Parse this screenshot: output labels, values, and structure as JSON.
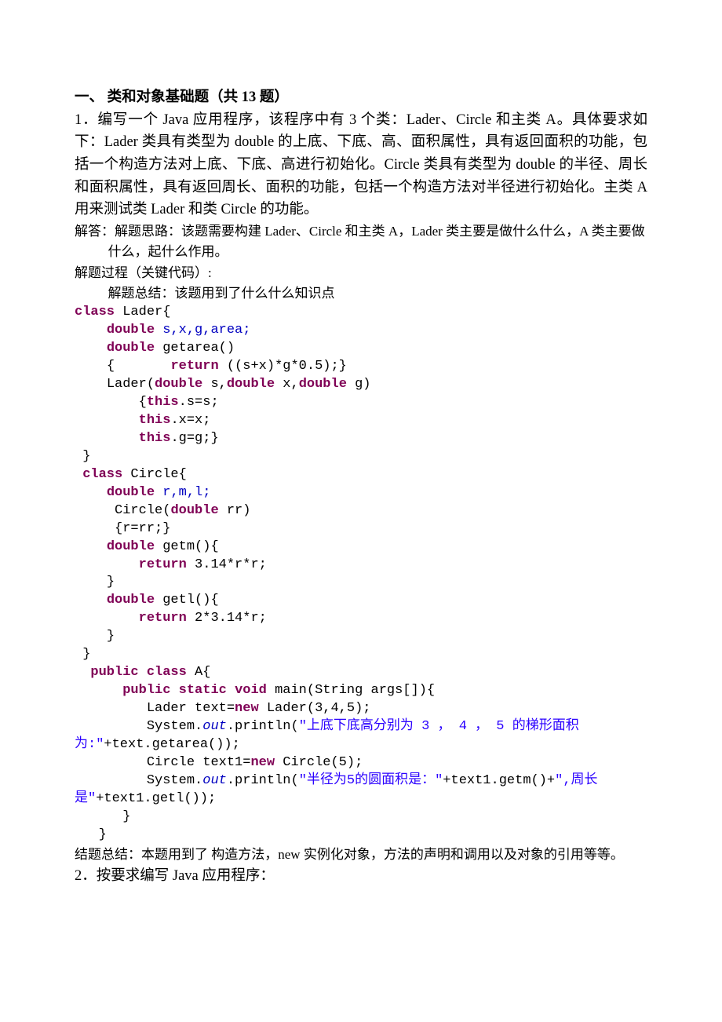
{
  "section_title": "一、   类和对象基础题（共 13 题）",
  "problem1": {
    "body": "1．编写一个 Java 应用程序，该程序中有 3 个类：Lader、Circle 和主类 A。具体要求如下：Lader 类具有类型为 double 的上底、下底、高、面积属性，具有返回面积的功能，包括一个构造方法对上底、下底、高进行初始化。Circle 类具有类型为 double 的半径、周长和面积属性，具有返回周长、面积的功能，包括一个构造方法对半径进行初始化。主类 A 用来测试类 Lader 和类 Circle 的功能。",
    "answer_line": "解答：解题思路：该题需要构建 Lader、Circle 和主类 A，Lader 类主要是做什么什么，A 类主要做什么，起什么作用。",
    "process_line": "解题过程（关键代码）:",
    "summary_hint": "解题总结：该题用到了什么什么知识点"
  },
  "code": {
    "t": {
      "class": "class",
      "double": "double",
      "return": "return",
      "this": "this",
      "public": "public",
      "static": "static",
      "void": "void",
      "new": "new"
    },
    "lader": "Lader{",
    "fields_lader": ",x,g,area;",
    "field_s": "s",
    "getarea_sig": " getarea()",
    "getarea_body_pre": "    {       ",
    "getarea_body_post": " ((s+x)*g*0.5);}",
    "lader_ctor_pre": "    Lader(",
    "lader_ctor_mid1": " s,",
    "lader_ctor_mid2": " x,",
    "lader_ctor_mid3": " g)",
    "lader_ctor_open": "        {",
    "lader_this_s": ".s=s;",
    "lader_this_x": ".x=x;",
    "lader_this_g": ".g=g;}",
    "close1": " }",
    "circle": "Circle{",
    "fields_circle": ",m,l;",
    "field_r": "r",
    "circle_ctor_sig": "     Circle(",
    "circle_ctor_arg": " rr)",
    "circle_ctor_body": "     {r=rr;}",
    "getm_sig": " getm(){",
    "getm_ret": " 3.14*r*r;",
    "getl_sig": " getl(){",
    "getl_ret": " 2*3.14*r;",
    "brace_close_4": "    }",
    "a_decl": " A{",
    "main_pre": "      ",
    "main_mid": " main(String args[]){",
    "lader_new_pre": "         Lader text=",
    "lader_new_post": " Lader(3,4,5);",
    "sys_pre": "         System.",
    "out": "out",
    "println1": ".println(",
    "str1": "\"上底下底高分别为 3 ， 4 ， 5 的梯形面积为:\"",
    "str1_tail": "+text.getarea());",
    "circle_new_pre": "         Circle text1=",
    "circle_new_post": " Circle(5);",
    "str2a": "\"半径为5的圆面积是：\"",
    "str2_mid": "+text1.getm()+",
    "str2b": "\",周长是\"",
    "str2_tail": "+text1.getl());",
    "brace_close_6": "      }",
    "brace_close_3": "   }"
  },
  "conclusion": "结题总结：本题用到了 构造方法，new 实例化对象，方法的声明和调用以及对象的引用等等。",
  "problem2": "2．按要求编写 Java 应用程序："
}
